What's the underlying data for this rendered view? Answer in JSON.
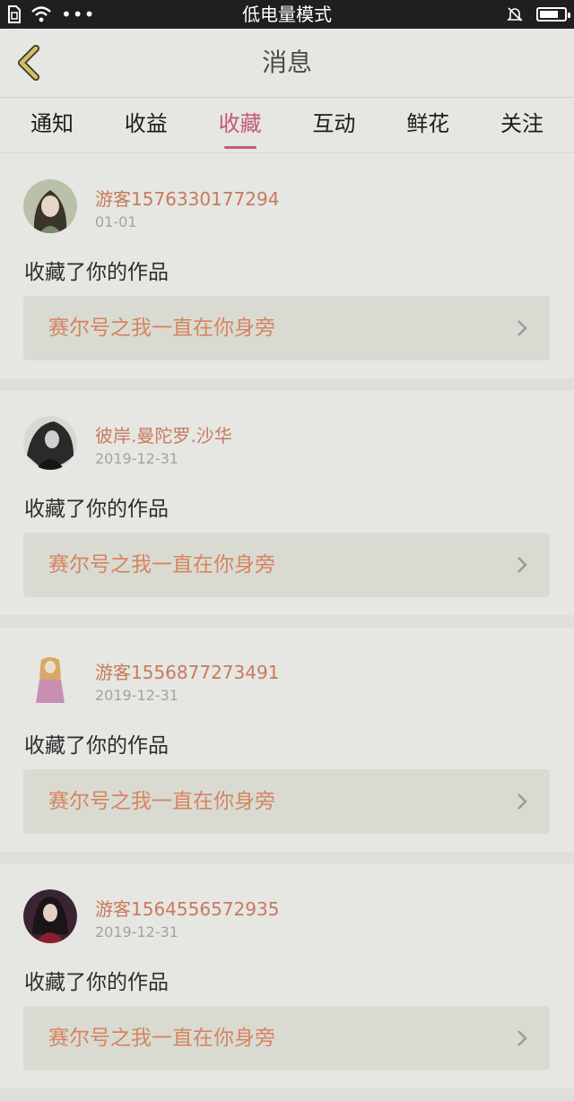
{
  "status_bar": {
    "title": "低电量模式",
    "dots": "•••"
  },
  "nav": {
    "title": "消息"
  },
  "tabs": [
    {
      "label": "通知",
      "active": false
    },
    {
      "label": "收益",
      "active": false
    },
    {
      "label": "收藏",
      "active": true
    },
    {
      "label": "互动",
      "active": false
    },
    {
      "label": "鲜花",
      "active": false
    },
    {
      "label": "关注",
      "active": false
    }
  ],
  "colors": {
    "accent": "#c25a7a",
    "username": "#c77a5e",
    "work_title": "#d6845f"
  },
  "items": [
    {
      "user": "游客1576330177294",
      "date": "01-01",
      "action": "收藏了你的作品",
      "work": "赛尔号之我一直在你身旁"
    },
    {
      "user": "彼岸.曼陀罗.沙华",
      "date": "2019-12-31",
      "action": "收藏了你的作品",
      "work": "赛尔号之我一直在你身旁"
    },
    {
      "user": "游客1556877273491",
      "date": "2019-12-31",
      "action": "收藏了你的作品",
      "work": "赛尔号之我一直在你身旁"
    },
    {
      "user": "游客1564556572935",
      "date": "2019-12-31",
      "action": "收藏了你的作品",
      "work": "赛尔号之我一直在你身旁"
    }
  ]
}
